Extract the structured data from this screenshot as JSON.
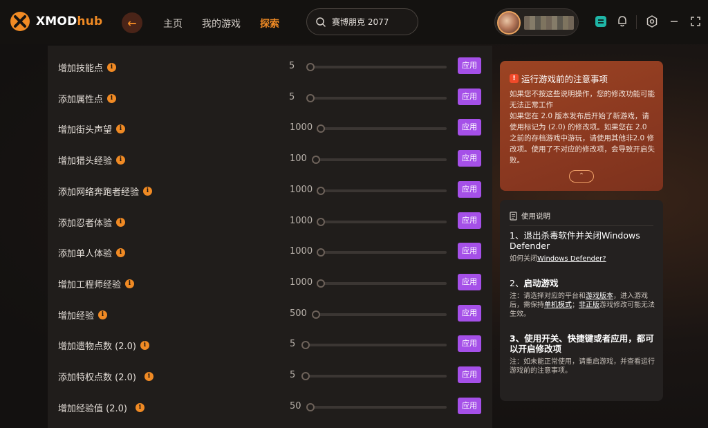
{
  "app": {
    "logo_main": "XMOD",
    "logo_sub": "hub"
  },
  "nav": {
    "items": [
      "主页",
      "我的游戏",
      "探索"
    ],
    "active": "探索"
  },
  "search": {
    "value": "赛博朋克 2077"
  },
  "colors": {
    "accent": "#f08a24",
    "apply": "#a550e8",
    "notice_bg": "#9c4423"
  },
  "apply_label": "应用",
  "mods": [
    {
      "label": "增加技能点",
      "value": "5"
    },
    {
      "label": "添加属性点",
      "value": "5"
    },
    {
      "label": "增加街头声望",
      "value": "1000"
    },
    {
      "label": "增加猎头经验",
      "value": "100"
    },
    {
      "label": "添加网络奔跑者经验",
      "value": "1000"
    },
    {
      "label": "添加忍者体验",
      "value": "1000"
    },
    {
      "label": "添加单人体验",
      "value": "1000"
    },
    {
      "label": "增加工程师经验",
      "value": "1000"
    },
    {
      "label": "增加经验",
      "value": "500"
    },
    {
      "label": "增加遗物点数 (2.0)",
      "value": "5"
    },
    {
      "label": "添加特权点数 (2.0)",
      "value": "5"
    },
    {
      "label": "增加经验值 (2.0)",
      "value": "50"
    }
  ],
  "notice": {
    "title": "运行游戏前的注意事项",
    "line1": "如果您不按这些说明操作，您的修改功能可能无法正常工作",
    "line2": "如果您在 2.0 版本发布后开始了新游戏，请使用标记为 (2.0) 的修改项。如果您在 2.0 之前的存档游戏中游玩，请使用其他非2.0 修改项。使用了不对应的修改项，会导致开启失败。",
    "collapse_icon": "chevron-up-icon"
  },
  "guide": {
    "header": "使用说明",
    "step1_title": "1、退出杀毒软件并关闭Windows Defender",
    "step1_note_prefix": "如何关闭",
    "step1_note_link": "Windows Defender?",
    "step2_title_num": "2、",
    "step2_title": "启动游戏",
    "step2_note_a": "注：请选择对应的平台和",
    "step2_note_link1": "游戏版本",
    "step2_note_b": "，进入游戏后，需保持",
    "step2_note_link2": "单机模式",
    "step2_note_c": "；",
    "step2_note_link3": "非正版",
    "step2_note_d": "游戏修改可能无法生效。",
    "step3_title": "3、使用开关、快捷键或者应用，都可以开启修改项",
    "step3_note": "注：如未能正常使用，请重启游戏，并查看运行游戏前的注意事项。"
  }
}
